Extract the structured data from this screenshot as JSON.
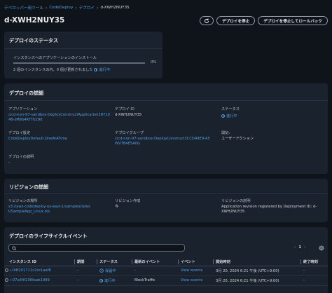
{
  "breadcrumb": {
    "items": [
      "デベロッパー用ツール",
      "CodeDeploy",
      "デプロイ"
    ],
    "current": "d-XWH2NUY35"
  },
  "page_title": "d-XWH2NUY35",
  "header": {
    "stop_label": "デプロイを停止",
    "stop_rollback_label": "デプロイを停止してロールバック"
  },
  "status_panel": {
    "title": "デプロイのステータス",
    "installing_label": "インスタンスへのアプリケーションのインストール",
    "percent": "0%",
    "progress_fraction": 0,
    "count_text": "2 個のインスタンスの内、0 個が更新されました",
    "count_status": "進行中"
  },
  "details_panel": {
    "title": "デプロイの詳細",
    "app_label": "アプリケーション",
    "app_value": "cicd-non-97-sandbox-DeployConstructApplication5871048-zM9b4KTTU29d",
    "id_label": "デプロイ ID",
    "id_value": "d-XWH2NUY35",
    "status_label": "ステータス",
    "status_value": "進行中",
    "config_label": "デプロイ設定",
    "config_value": "CodeDeployDefault.OneAtATime",
    "group_label": "デプロイグループ",
    "group_value": "cicd-non-97-sandbox-DeployConstruct3CCD49E9-A5WVTB4E5A0G",
    "initiated_label": "開始:",
    "initiated_value": "ユーザーアクション",
    "desc_label": "デプロイの説明",
    "desc_value": "-"
  },
  "revision_panel": {
    "title": "リビジョンの詳細",
    "location_label": "リビジョンの場所",
    "location_value": "s3://aws-codedeploy-us-east-1/samples/latest/SampleApp_Linux.zip",
    "created_label": "リビジョン作成",
    "created_value": "今",
    "desc_label": "リビジョンの説明",
    "desc_value": "Application revision registered by Deployment ID: d-XWH2NUY35"
  },
  "lifecycle_panel": {
    "title": "デプロイのライフサイクルイベント",
    "page_number": "1",
    "columns": [
      "インスタンス ID",
      "期間",
      "ステータス",
      "最新のイベント",
      "イベント",
      "開始時刻",
      "終了時刻"
    ],
    "rows": [
      {
        "instance": "i-04f201711c2cc1aef6",
        "duration": "-",
        "status": "保留中",
        "latest_event": "-",
        "events": "View events",
        "start": "3月 20, 2024 6:21 午後 (UTC+9:00)",
        "end": "-"
      },
      {
        "instance": "i-07a44f236faab1999",
        "duration": "-",
        "status": "進行中",
        "latest_event": "BlockTraffic",
        "events": "View events",
        "start": "3月 20, 2024 6:21 午後 (UTC+9:00)",
        "end": "-"
      }
    ]
  },
  "colors": {
    "background": "#0f141a",
    "panel": "#1a222d",
    "link": "#539fe5"
  }
}
